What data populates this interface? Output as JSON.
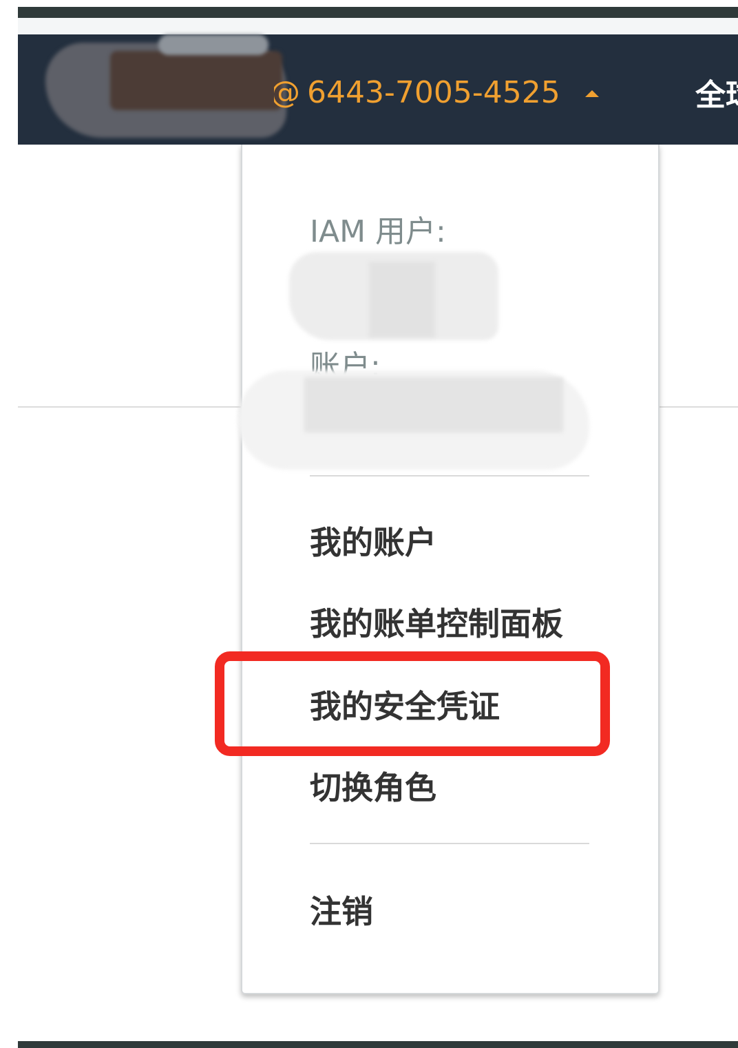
{
  "navbar": {
    "account_prefix": "@",
    "account_id": "6443-7005-4525",
    "next_item_fragment": "全球"
  },
  "account_menu": {
    "iam_user_label": "IAM 用户:",
    "account_label": "账户:",
    "items": [
      {
        "label": "我的账户"
      },
      {
        "label": "我的账单控制面板"
      },
      {
        "label": "我的安全凭证"
      },
      {
        "label": "切换角色"
      }
    ],
    "sign_out_label": "注销"
  },
  "annotation": {
    "highlight_color": "#f22a22",
    "highlighted_item": "我的安全凭证"
  },
  "colors": {
    "navbar_bg": "#232f3e",
    "account_text": "#f0a030"
  }
}
